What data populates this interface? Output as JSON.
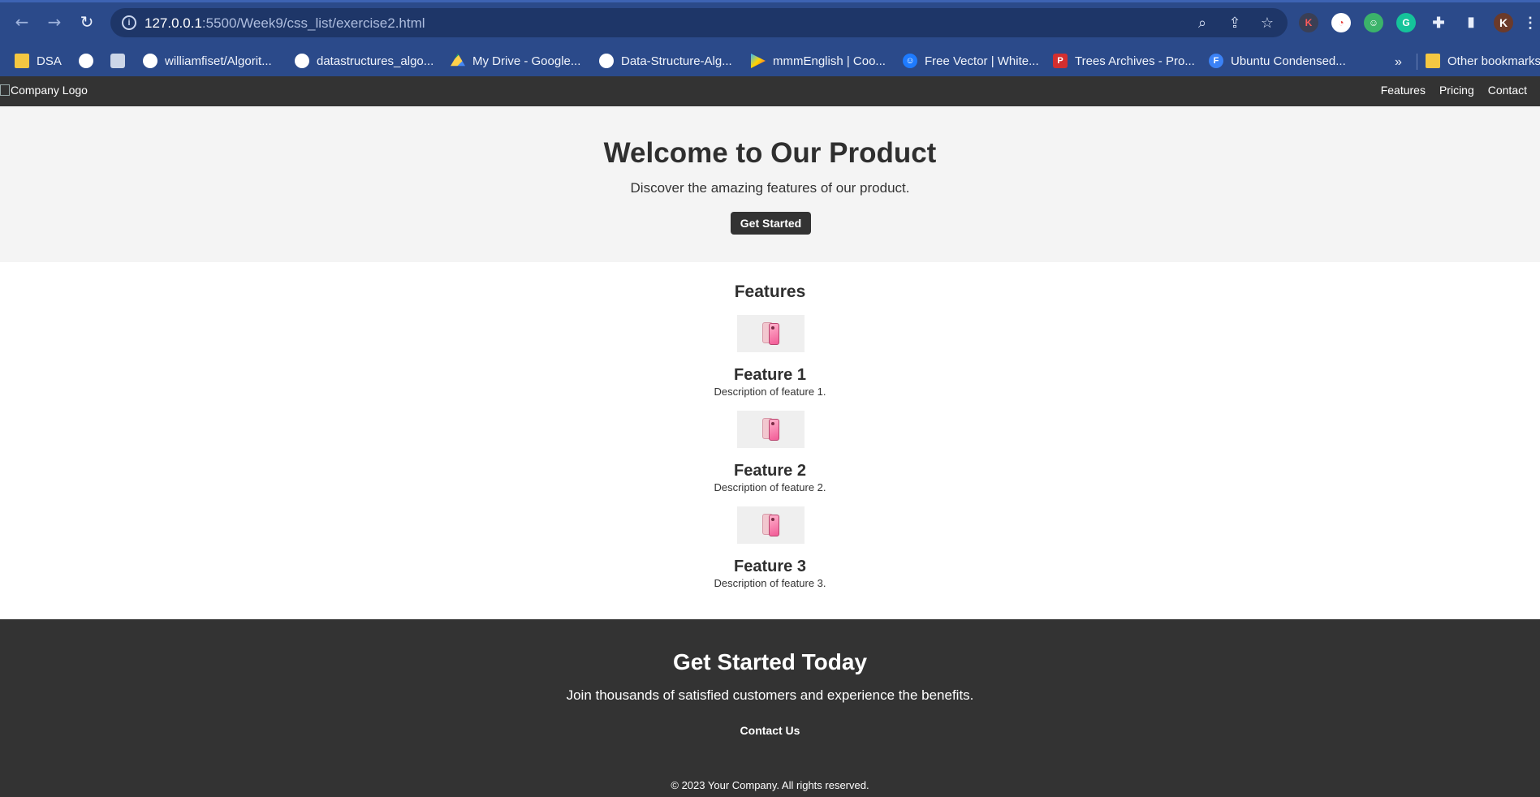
{
  "browser": {
    "url_host": "127.0.0.1",
    "url_path": ":5500/Week9/css_list/exercise2.html",
    "bookmarks": [
      {
        "label": "DSA",
        "icon": "folder-icon"
      },
      {
        "label": "",
        "icon": "globe-icon"
      },
      {
        "label": "",
        "icon": "gear-icon"
      },
      {
        "label": "williamfiset/Algorit...",
        "icon": "github-icon"
      },
      {
        "label": "datastructures_algo...",
        "icon": "github-icon"
      },
      {
        "label": "My Drive - Google...",
        "icon": "google-drive-icon"
      },
      {
        "label": "Data-Structure-Alg...",
        "icon": "github-icon"
      },
      {
        "label": "mmmEnglish | Coo...",
        "icon": "play-icon"
      },
      {
        "label": "Free Vector | White...",
        "icon": "freepik-icon"
      },
      {
        "label": "Trees Archives - Pro...",
        "icon": "trees-icon"
      },
      {
        "label": "Ubuntu Condensed...",
        "icon": "font-icon"
      }
    ],
    "more_bookmarks": "»",
    "other_bookmarks": "Other bookmarks",
    "profile_initial": "K"
  },
  "site": {
    "logo_alt": "Company Logo",
    "nav": [
      "Features",
      "Pricing",
      "Contact"
    ],
    "hero": {
      "title": "Welcome to Our Product",
      "subtitle": "Discover the amazing features of our product.",
      "button": "Get Started"
    },
    "features": {
      "heading": "Features",
      "items": [
        {
          "title": "Feature 1",
          "description": "Description of feature 1."
        },
        {
          "title": "Feature 2",
          "description": "Description of feature 2."
        },
        {
          "title": "Feature 3",
          "description": "Description of feature 3."
        }
      ]
    },
    "cta": {
      "title": "Get Started Today",
      "text": "Join thousands of satisfied customers and experience the benefits.",
      "link": "Contact Us"
    },
    "footer": "© 2023 Your Company. All rights reserved."
  },
  "colors": {
    "browser_bg": "#2b4a8a",
    "header_bg": "#333333",
    "hero_bg": "#f4f4f4"
  }
}
